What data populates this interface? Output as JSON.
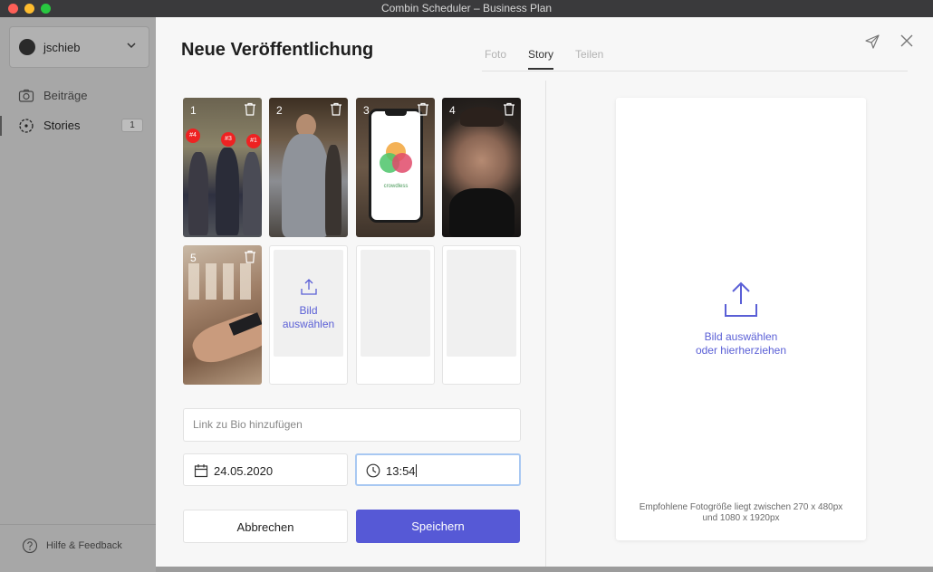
{
  "window": {
    "title": "Combin Scheduler  – Business Plan"
  },
  "sidebar": {
    "account": "jschieb",
    "items": [
      {
        "label": "Beiträge",
        "icon": "camera-icon"
      },
      {
        "label": "Stories",
        "icon": "story-icon",
        "badge": "1",
        "active": true
      }
    ],
    "help": "Hilfe & Feedback"
  },
  "modal": {
    "title": "Neue Veröffentlichung",
    "tabs": [
      "Foto",
      "Story",
      "Teilen"
    ],
    "active_tab": "Story",
    "thumbnails": [
      {
        "index": "1",
        "tags": [
          "#4",
          "#3",
          "#1"
        ]
      },
      {
        "index": "2"
      },
      {
        "index": "3",
        "brand": "crowdless"
      },
      {
        "index": "4"
      },
      {
        "index": "5"
      }
    ],
    "upload_cell_label": "Bild\nauswählen",
    "link_placeholder": "Link zu Bio hinzufügen",
    "date": "24.05.2020",
    "time": "13:54",
    "cancel_label": "Abbrechen",
    "save_label": "Speichern",
    "preview": {
      "upload_text": "Bild auswählen\noder hierherziehen",
      "hint": "Empfohlene Fotogröße liegt zwischen 270 x 480px und 1080 x 1920px"
    }
  },
  "colors": {
    "accent": "#5659d6",
    "link": "#5a5fd6",
    "sidebar_bg": "#a7a7a7",
    "modal_bg": "#f7f7f7"
  }
}
